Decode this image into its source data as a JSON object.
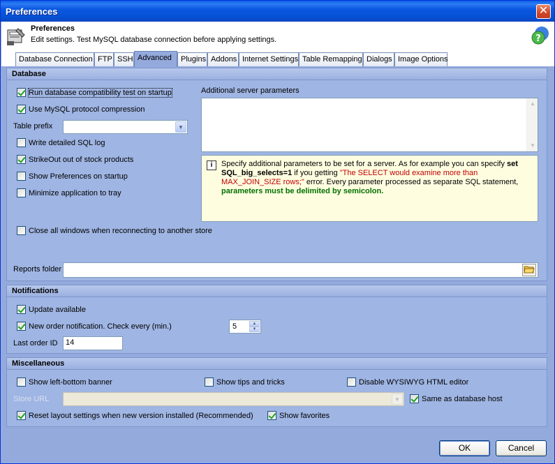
{
  "window": {
    "title": "Preferences"
  },
  "header": {
    "title": "Preferences",
    "description": "Edit settings. Test MySQL database connection before applying settings."
  },
  "tabs": [
    {
      "label": "Database Connection"
    },
    {
      "label": "FTP"
    },
    {
      "label": "SSH"
    },
    {
      "label": "Advanced"
    },
    {
      "label": "Plugins"
    },
    {
      "label": "Addons"
    },
    {
      "label": "Internet Settings"
    },
    {
      "label": "Table Remapping"
    },
    {
      "label": "Dialogs"
    },
    {
      "label": "Image Options"
    }
  ],
  "database": {
    "heading": "Database",
    "run_compat_test": "Run database compatibility test on startup",
    "use_compression": "Use MySQL protocol compression",
    "table_prefix_label": "Table prefix",
    "table_prefix_value": "",
    "write_sql_log": "Write detailed SQL log",
    "strikeout": "StrikeOut out of stock products",
    "show_prefs_startup": "Show Preferences on startup",
    "minimize_tray": "Minimize application to tray",
    "close_windows": "Close all windows when reconnecting to another store",
    "additional_params_label": "Additional server parameters",
    "additional_params_value": "",
    "info_p1": "Specify additional parameters to be set for a server. As for example you can specify ",
    "info_b1": "set SQL_big_selects=1",
    "info_p2": " if you getting ",
    "info_red": "\"The SELECT would examine more than MAX_JOIN_SIZE rows;\"",
    "info_p3": " error. Every parameter processed as separate SQL statement, ",
    "info_green": "parameters must be delimited by semicolon.",
    "reports_folder_label": "Reports folder",
    "reports_folder_value": ""
  },
  "notifications": {
    "heading": "Notifications",
    "update_available": "Update available",
    "new_order": "New order notification. Check every (min.)",
    "check_every_value": "5",
    "last_order_label": "Last order ID",
    "last_order_value": "14"
  },
  "misc": {
    "heading": "Miscellaneous",
    "show_banner": "Show left-bottom banner",
    "show_tips": "Show tips and tricks",
    "disable_wysiwyg": "Disable WYSIWYG HTML editor",
    "store_url_label": "Store URL",
    "store_url_value": "",
    "same_as_host": "Same as database host",
    "reset_layout": "Reset layout settings when new version installed (Recommended)",
    "show_favorites": "Show favorites"
  },
  "buttons": {
    "ok": "OK",
    "cancel": "Cancel"
  }
}
